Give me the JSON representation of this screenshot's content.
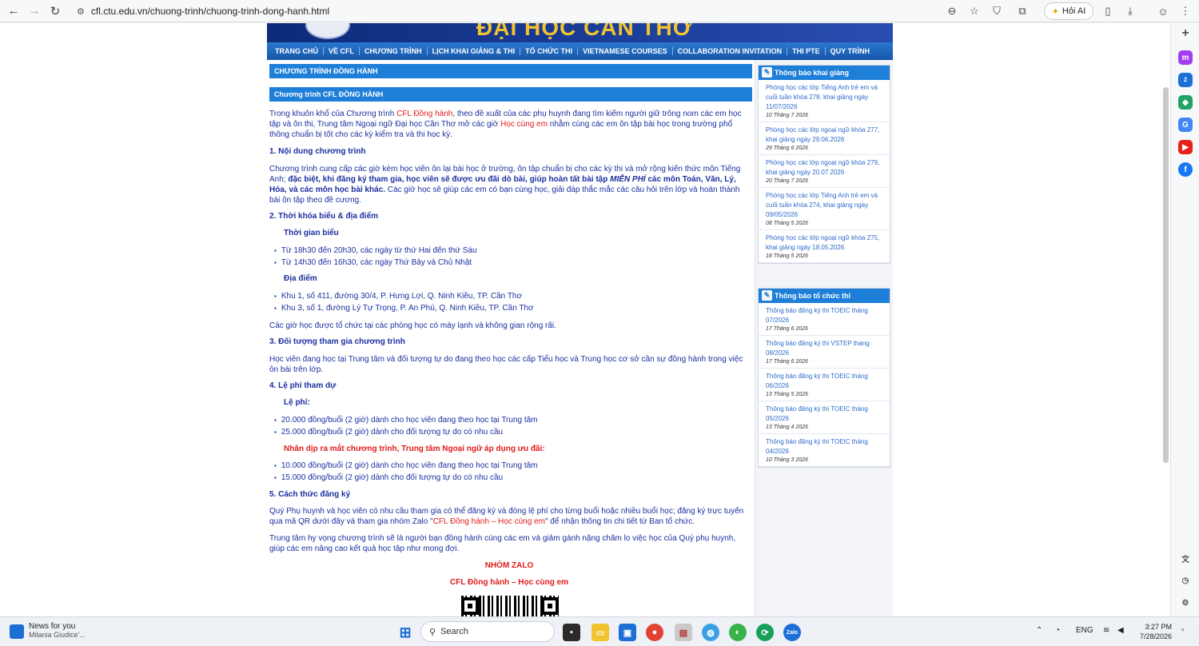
{
  "browser": {
    "url": "cfl.ctu.edu.vn/chuong-trinh/chuong-trinh-dong-hanh.html",
    "hoi_ai": "Hỏi AI"
  },
  "site": {
    "banner_title": "ĐẠI HỌC CẦN THƠ",
    "menu": [
      "TRANG CHỦ",
      "VỀ CFL",
      "CHƯƠNG TRÌNH",
      "LỊCH KHAI GIẢNG & THI",
      "TỔ CHỨC THI",
      "VIETNAMESE COURSES",
      "COLLABORATION INVITATION",
      "THI PTE",
      "QUY TRÌNH"
    ]
  },
  "main": {
    "heading1": "CHƯƠNG TRÌNH ĐỒNG HÀNH",
    "heading2": "Chương trình CFL ĐỒNG HÀNH",
    "intro_a": "Trong khuôn khổ của Chương trình ",
    "intro_b": "CFL Đồng hành",
    "intro_c": ", theo đề xuất của các phụ huynh đang tìm kiếm người giữ trông nom các em học tập và ôn thi, Trung tâm Ngoại ngữ Đại học Cần Thơ mở các giờ ",
    "intro_d": "Học cùng em",
    "intro_e": " nhằm cùng các em ôn tập bài học trong trường phổ thông chuẩn bị tốt cho các kỳ kiểm tra và thi học kỳ.",
    "s1": "1. Nội dung chương trình",
    "s1_a": "Chương trình cung cấp các giờ kèm học viên ôn lại bài học ở trường, ôn tập chuẩn bị cho các kỳ thi và mở rộng kiến thức môn Tiếng Anh; ",
    "s1_b": "đặc biệt, khi đăng ký tham gia, học viên sẽ được ưu đãi dò bài, giúp hoàn tất bài tập ",
    "s1_c": "MIỄN PHÍ",
    "s1_d": " các môn Toán, Văn, Lý, Hóa, và các môn học bài khác.",
    "s1_e": " Các giờ học sẽ giúp các em có bạn cùng học, giải đáp thắc mắc các câu hỏi trên lớp và hoàn thành bài ôn tập theo đề cương.",
    "s2": "2. Thời khóa biểu & địa điểm",
    "s2_sub1": "Thời gian biểu",
    "s2_t1": "Từ 18h30 đến 20h30, các ngày từ thứ Hai đến thứ Sáu",
    "s2_t2": "Từ 14h30 đến 16h30, các ngày Thứ Bảy và Chủ Nhật",
    "s2_sub2": "Địa điểm",
    "s2_p1": "Khu 1, số 411, đường 30/4, P. Hưng Lợi, Q. Ninh Kiều, TP. Cần Thơ",
    "s2_p2": "Khu 3, số 1, đường Lý Tự Trọng, P. An Phú, Q. Ninh Kiều, TP. Cần Thơ",
    "s2_note": "Các giờ học được tổ chức tại các phòng học có máy lạnh và không gian rộng rãi.",
    "s3": "3. Đối tượng tham gia chương trình",
    "s3_text": "Học viên đang học tại Trung tâm và đối tượng tự do đang theo học các cấp Tiểu học và Trung học cơ sở cần sự đồng hành trong việc ôn bài trên lớp.",
    "s4": "4. Lệ phí tham dự",
    "s4_sub1": "Lệ phí:",
    "s4_f1": "20.000 đồng/buổi (2 giờ) dành cho học viên đang theo học tại Trung tâm",
    "s4_f2": "25.000 đồng/buổi (2 giờ) dành cho đối tượng tự do có nhu cầu",
    "s4_sub2": "Nhân dịp ra mắt chương trình, Trung tâm Ngoại ngữ áp dụng ưu đãi:",
    "s4_f3": "10.000 đồng/buổi (2 giờ) dành cho học viên đang theo học tại Trung tâm",
    "s4_f4": "15.000 đồng/buổi (2 giờ) dành cho đối tượng tự do có nhu cầu",
    "s5": "5. Cách thức đăng ký",
    "s5_a": "Quý Phụ huynh và học viên có nhu cầu tham gia có thể đăng ký và đóng lệ phí cho từng buổi hoặc nhiều buổi học; đăng ký trực tuyến qua mã QR dưới đây và tham gia nhóm Zalo \"",
    "s5_b": "CFL Đồng hành – Học cùng em",
    "s5_c": "\" để nhận thông tin chi tiết từ Ban tổ chức.",
    "closing": "Trung tâm hy vọng chương trình sẽ là người bạn đồng hành cùng các em và giảm gánh nặng chăm lo việc học của Quý phụ huynh, giúp các em nâng cao kết quả học tập như mong đợi.",
    "zalo_title": "NHÓM ZALO",
    "zalo_name": "CFL Đồng hành – Học cùng em"
  },
  "sidebar": {
    "box1_title": "Thông báo khai giảng",
    "box1_items": [
      {
        "t": "Phòng học các lớp Tiếng Anh trẻ em và cuối tuần khóa 278, khai giảng ngày 11/07/2026",
        "d": "10 Tháng 7 2026"
      },
      {
        "t": "Phòng học các lớp ngoại ngữ khóa 277, khai giảng ngày 29.06.2026",
        "d": "29 Tháng 6 2026"
      },
      {
        "t": "Phòng học các lớp ngoại ngữ khóa 279, khai giảng ngày 20.07.2026",
        "d": "20 Tháng 7 2026"
      },
      {
        "t": "Phòng học các lớp Tiếng Anh trẻ em và cuối tuần khóa 274, khai giảng ngày 09/05/2026",
        "d": "08 Tháng 5 2026"
      },
      {
        "t": "Phòng học các lớp ngoại ngữ khóa 275, khai giảng ngày 18.05.2026",
        "d": "18 Tháng 5 2026"
      }
    ],
    "box2_title": "Thông báo tổ chức thi",
    "box2_items": [
      {
        "t": "Thông báo đăng ký thi TOEIC tháng 07/2026",
        "d": "17 Tháng 6 2026"
      },
      {
        "t": "Thông báo đăng ký thi VSTEP tháng 08/2026",
        "d": "17 Tháng 6 2026"
      },
      {
        "t": "Thông báo đăng ký thi TOEIC tháng 06/2026",
        "d": "13 Tháng 5 2026"
      },
      {
        "t": "Thông báo đăng ký thi TOEIC tháng 05/2026",
        "d": "13 Tháng 4 2026"
      },
      {
        "t": "Thông báo đăng ký thi TOEIC tháng 04/2026",
        "d": "10 Tháng 3 2026"
      }
    ]
  },
  "taskbar": {
    "news_title": "News for you",
    "news_sub": "Milania Giudice'...",
    "search": "Search",
    "lang": "ENG",
    "time": "3:27 PM",
    "date": "7/28/2026"
  }
}
